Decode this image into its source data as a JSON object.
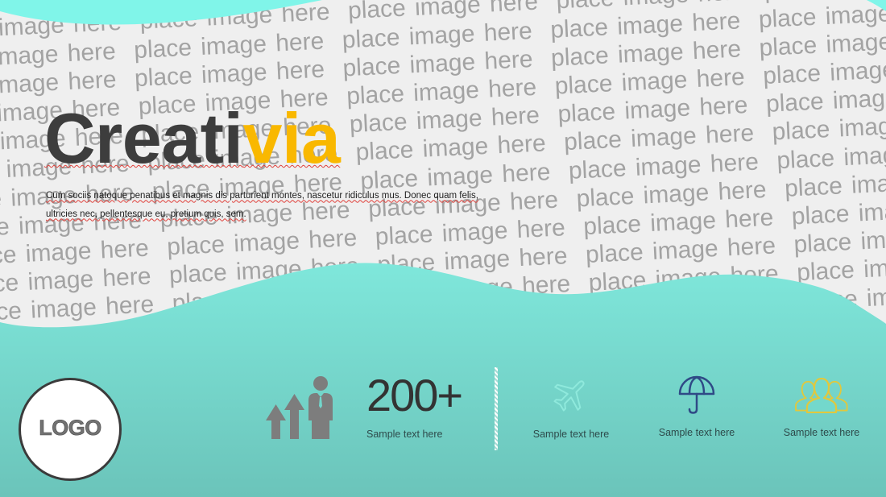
{
  "slide": {
    "placeholder_pattern": {
      "text": "place image here",
      "rows": 14
    },
    "title": {
      "part1": "Creati",
      "part2": "via"
    },
    "paragraph": {
      "lines": [
        "Cum sociis natoque penatibus et magnis dis parturient montes, nascetur ridiculus mus. Donec quam felis,",
        "ultricies nec, pellentesque eu, pretium quis, sem."
      ]
    },
    "logo": {
      "label": "LOGO"
    },
    "stat": {
      "icon": "growth-arrows-person-icon",
      "value": "200+",
      "caption": "Sample text here"
    },
    "features": [
      {
        "icon": "airplane-icon",
        "caption": "Sample text here"
      },
      {
        "icon": "umbrella-icon",
        "caption": "Sample text here"
      },
      {
        "icon": "people-group-icon",
        "caption": "Sample text here"
      }
    ]
  },
  "colors": {
    "accent": "#f9b800",
    "title_dark": "#3d3d3d",
    "teal_top": "#80f5e9",
    "teal_wave_top": "#7fe7db",
    "teal_wave_bottom": "#6bc4ba",
    "plane": "#8fe9dc",
    "umbrella": "#2f4a86",
    "people": "#e0c83e"
  }
}
